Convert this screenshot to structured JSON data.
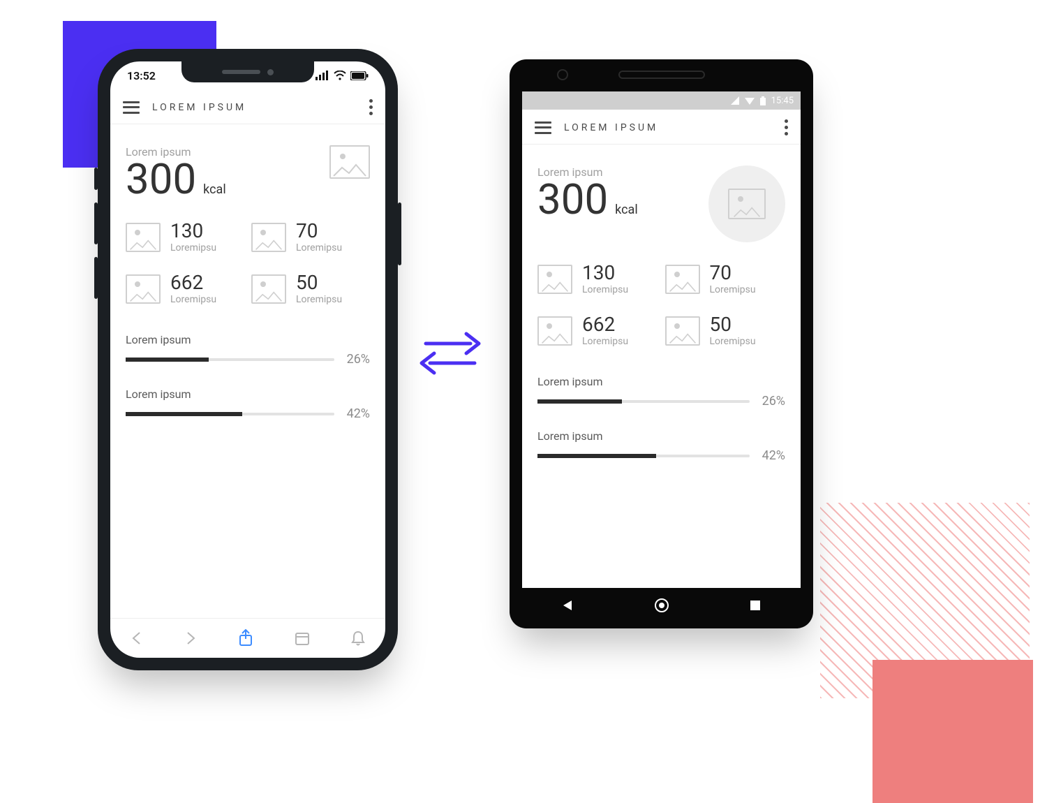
{
  "header": {
    "title": "LOREM IPSUM"
  },
  "ios_status": {
    "time": "13:52"
  },
  "android_status": {
    "time": "15:45"
  },
  "hero": {
    "sub": "Lorem ipsum",
    "value": "300",
    "unit": "kcal"
  },
  "stats": [
    {
      "value": "130",
      "label": "Loremipsu"
    },
    {
      "value": "70",
      "label": "Loremipsu"
    },
    {
      "value": "662",
      "label": "Loremipsu"
    },
    {
      "value": "50",
      "label": "Loremipsu"
    }
  ],
  "progress": [
    {
      "label": "Lorem ipsum",
      "pct": "26%",
      "fill": 40
    },
    {
      "label": "Lorem ipsum",
      "pct": "42%",
      "fill": 56
    }
  ]
}
